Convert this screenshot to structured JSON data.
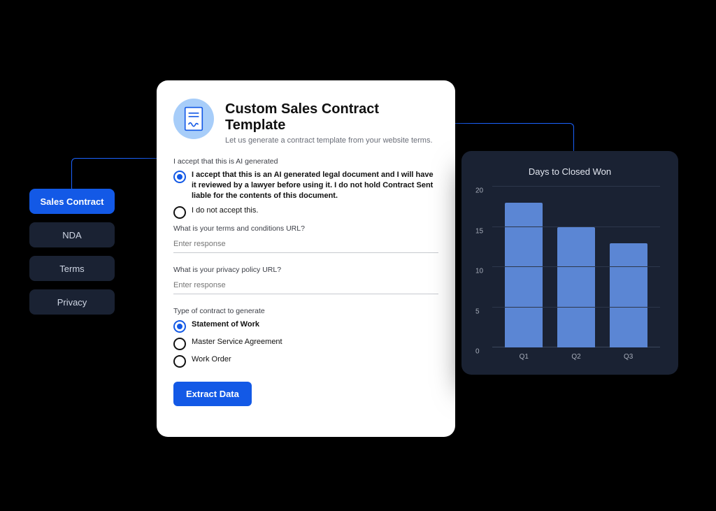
{
  "sidebar": {
    "items": [
      {
        "label": "Sales Contract",
        "active": true
      },
      {
        "label": "NDA",
        "active": false
      },
      {
        "label": "Terms",
        "active": false
      },
      {
        "label": "Privacy",
        "active": false
      }
    ]
  },
  "form": {
    "title": "Custom Sales Contract Template",
    "subtitle": "Let us generate a contract template from your website terms.",
    "ai_section_label": "I accept that this is AI generated",
    "ai_options": {
      "accept": "I accept that this is an AI generated legal document and I will have it reviewed by a lawyer before using it. I do not hold Contract Sent liable for the contents of this document.",
      "reject": "I do not accept this."
    },
    "terms_label": "What is your terms and conditions URL?",
    "terms_placeholder": "Enter response",
    "privacy_label": "What is your privacy policy URL?",
    "privacy_placeholder": "Enter response",
    "type_label": "Type of contract to generate",
    "type_options": {
      "sow": "Statement of Work",
      "msa": "Master Service Agreement",
      "wo": "Work Order"
    },
    "submit_label": "Extract Data"
  },
  "chart_data": {
    "type": "bar",
    "title": "Days to Closed Won",
    "categories": [
      "Q1",
      "Q2",
      "Q3"
    ],
    "values": [
      18,
      15,
      13
    ],
    "ylabel": "",
    "xlabel": "",
    "ylim": [
      0,
      20
    ],
    "yticks": [
      0,
      5,
      10,
      15,
      20
    ]
  }
}
